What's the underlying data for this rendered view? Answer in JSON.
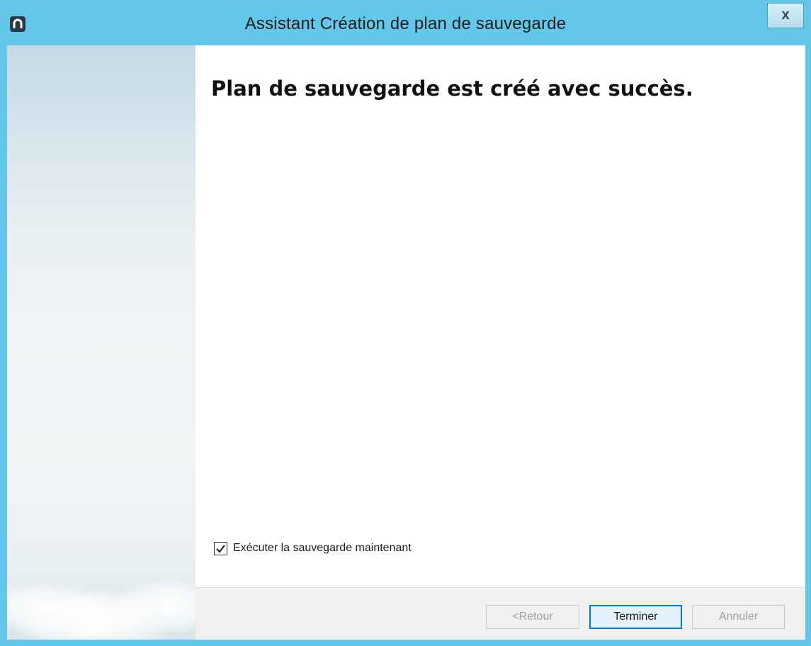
{
  "window": {
    "title": "Assistant Création de plan de sauvegarde",
    "close_label": "x"
  },
  "content": {
    "heading": "Plan de sauvegarde est créé avec succès.",
    "run_now": {
      "label": "Exécuter la sauvegarde maintenant",
      "checked": true
    }
  },
  "footer": {
    "back_label": "<Retour",
    "finish_label": "Terminer",
    "cancel_label": "Annuler"
  },
  "colors": {
    "titlebar": "#63c7ea",
    "default_button_border": "#0078d7"
  }
}
